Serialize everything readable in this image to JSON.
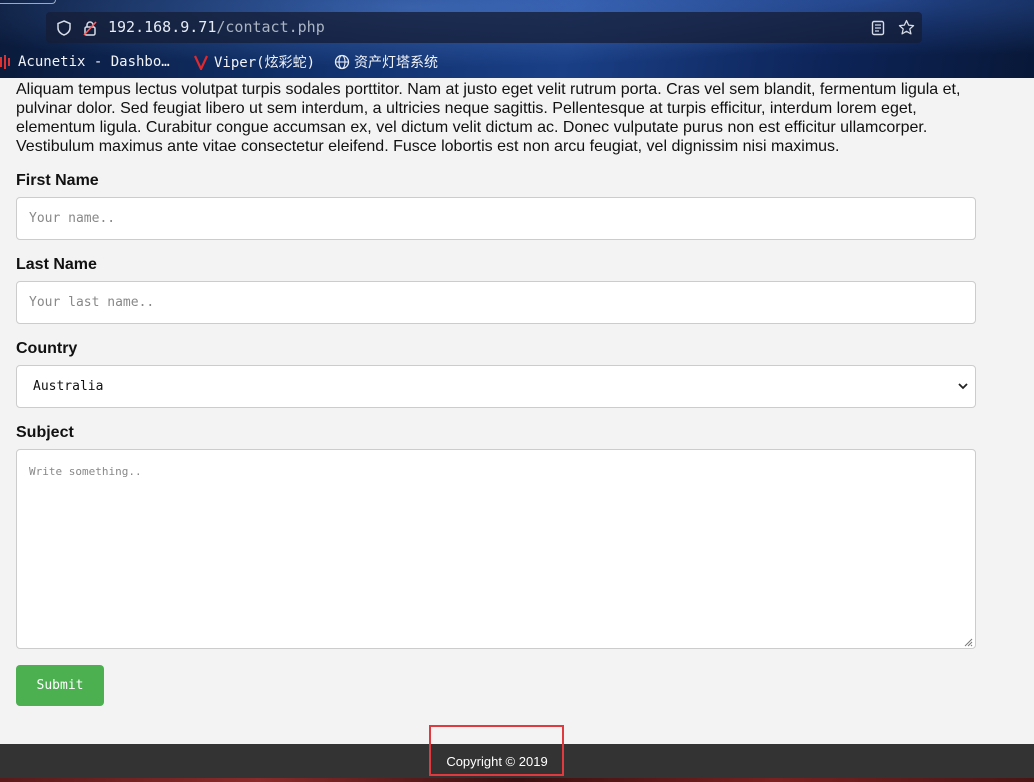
{
  "browser": {
    "url_host": "192.168.9.71",
    "url_path": "/contact.php",
    "bookmarks": [
      {
        "label": "Acunetix - Dashbo…",
        "icon": "acunetix-icon"
      },
      {
        "label": "Viper(炫彩蛇)",
        "icon": "viper-icon"
      },
      {
        "label": "资产灯塔系统",
        "icon": "globe-icon"
      }
    ]
  },
  "page": {
    "intro": "Aliquam tempus lectus volutpat turpis sodales porttitor. Nam at justo eget velit rutrum porta. Cras vel sem blandit, fermentum ligula et, pulvinar dolor. Sed feugiat libero ut sem interdum, a ultricies neque sagittis. Pellentesque at turpis efficitur, interdum lorem eget, elementum ligula. Curabitur congue accumsan ex, vel dictum velit dictum ac. Donec vulputate purus non est efficitur ullamcorper. Vestibulum maximus ante vitae consectetur eleifend. Fusce lobortis est non arcu feugiat, vel dignissim nisi maximus.",
    "form": {
      "first_name_label": "First Name",
      "first_name_placeholder": "Your name..",
      "last_name_label": "Last Name",
      "last_name_placeholder": "Your last name..",
      "country_label": "Country",
      "country_selected": "Australia",
      "subject_label": "Subject",
      "subject_placeholder": "Write something..",
      "submit_label": "Submit"
    },
    "footer": {
      "copyright": "Copyright © 2019"
    }
  },
  "colors": {
    "submit_green": "#4caf50",
    "footer_bg": "#333333",
    "highlight_red": "#e0393e"
  }
}
